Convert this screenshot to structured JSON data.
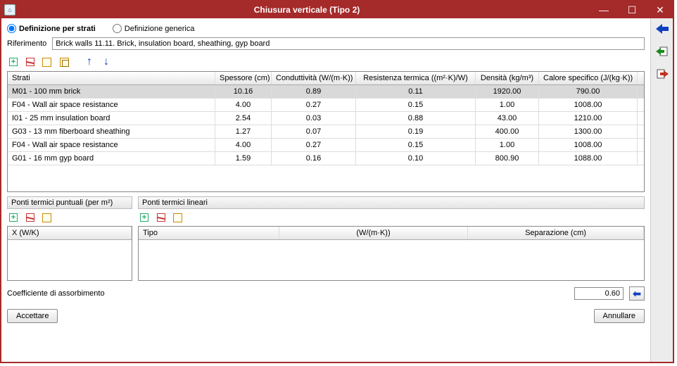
{
  "window": {
    "title": "Chiusura verticale (Tipo 2)"
  },
  "radio": {
    "perStrati": "Definizione per strati",
    "generica": "Definizione generica",
    "selected": "perStrati"
  },
  "ref": {
    "label": "Riferimento",
    "value": "Brick walls 11.11. Brick, insulation board, sheathing, gyp board"
  },
  "layers": {
    "headers": {
      "name": "Strati",
      "thickness": "Spessore (cm)",
      "conductivity": "Conduttività (W/(m·K))",
      "resistance": "Resistenza termica ((m²·K)/W)",
      "density": "Densità (kg/m³)",
      "specHeat": "Calore specifico (J/(kg·K))"
    },
    "rows": [
      {
        "name": "M01 - 100 mm brick",
        "thk": "10.16",
        "cond": "0.89",
        "res": "0.11",
        "dens": "1920.00",
        "cp": "790.00",
        "selected": true
      },
      {
        "name": "F04 - Wall air space resistance",
        "thk": "4.00",
        "cond": "0.27",
        "res": "0.15",
        "dens": "1.00",
        "cp": "1008.00"
      },
      {
        "name": "I01 - 25 mm insulation board",
        "thk": "2.54",
        "cond": "0.03",
        "res": "0.88",
        "dens": "43.00",
        "cp": "1210.00"
      },
      {
        "name": "G03 - 13 mm fiberboard sheathing",
        "thk": "1.27",
        "cond": "0.07",
        "res": "0.19",
        "dens": "400.00",
        "cp": "1300.00"
      },
      {
        "name": "F04 - Wall air space resistance",
        "thk": "4.00",
        "cond": "0.27",
        "res": "0.15",
        "dens": "1.00",
        "cp": "1008.00"
      },
      {
        "name": "G01 - 16 mm gyp board",
        "thk": "1.59",
        "cond": "0.16",
        "res": "0.10",
        "dens": "800.90",
        "cp": "1088.00"
      }
    ]
  },
  "pointBridges": {
    "title": "Ponti termici puntuali (per m²)",
    "header": "X (W/K)"
  },
  "linearBridges": {
    "title": "Ponti termici lineari",
    "headers": {
      "type": "Tipo",
      "coef": "(W/(m·K))",
      "sep": "Separazione (cm)"
    }
  },
  "absorb": {
    "label": "Coefficiente di assorbimento",
    "value": "0.60"
  },
  "buttons": {
    "ok": "Accettare",
    "cancel": "Annullare"
  }
}
